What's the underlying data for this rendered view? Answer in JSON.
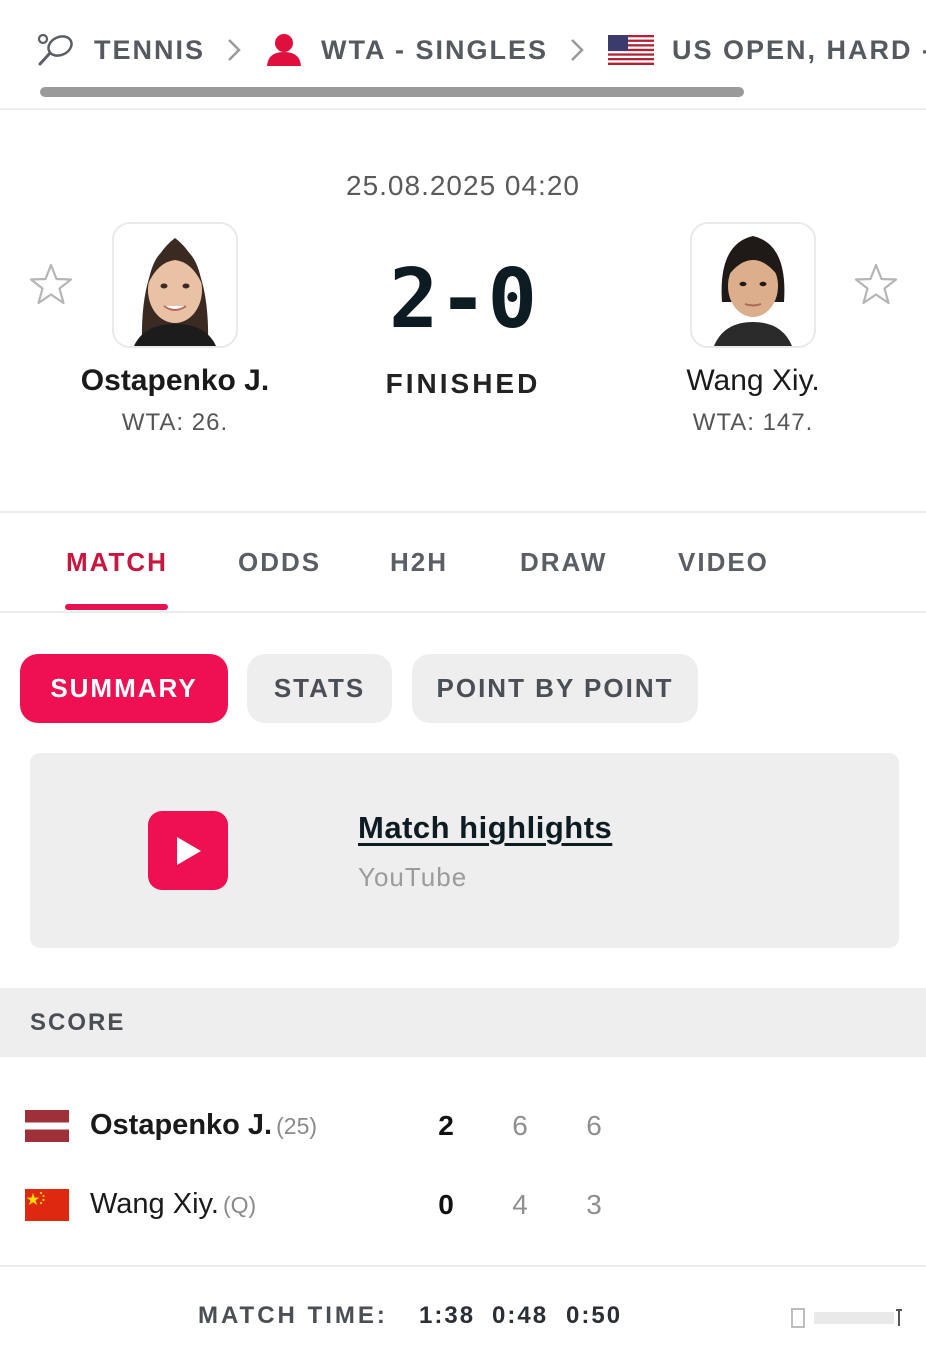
{
  "breadcrumb": {
    "sport": "TENNIS",
    "category": "WTA - SINGLES",
    "tournament": "US OPEN, HARD -"
  },
  "match": {
    "datetime": "25.08.2025 04:20",
    "score": "2-0",
    "status": "FINISHED"
  },
  "home": {
    "name": "Ostapenko J.",
    "ranking": "WTA: 26."
  },
  "away": {
    "name": "Wang Xiy.",
    "ranking": "WTA: 147."
  },
  "tabs": [
    "MATCH",
    "ODDS",
    "H2H",
    "DRAW",
    "VIDEO"
  ],
  "subtabs": [
    "SUMMARY",
    "STATS",
    "POINT BY POINT"
  ],
  "highlights": {
    "title": "Match highlights",
    "source": "YouTube"
  },
  "score_table": {
    "header": "SCORE",
    "rows": [
      {
        "name": "Ostapenko J.",
        "tag": "(25)",
        "total": "2",
        "sets": [
          "6",
          "6"
        ]
      },
      {
        "name": "Wang Xiy.",
        "tag": "(Q)",
        "total": "0",
        "sets": [
          "4",
          "3"
        ]
      }
    ],
    "match_time_label": "MATCH TIME:",
    "match_times": [
      "1:38",
      "0:48",
      "0:50"
    ]
  },
  "colors": {
    "accent": "#ee1050",
    "accent_text": "#c8163f",
    "dark": "#0d1b22"
  }
}
